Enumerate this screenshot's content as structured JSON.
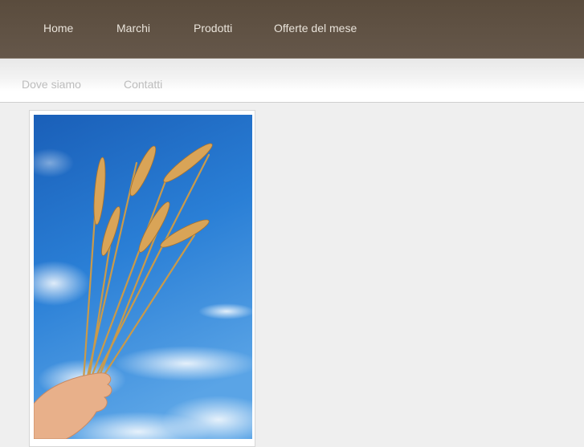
{
  "nav": {
    "primary": [
      {
        "label": "Home"
      },
      {
        "label": "Marchi"
      },
      {
        "label": "Prodotti"
      },
      {
        "label": "Offerte del mese"
      }
    ],
    "secondary": [
      {
        "label": "Dove siamo"
      },
      {
        "label": "Contatti"
      }
    ]
  },
  "colors": {
    "topbar": "#5f5142",
    "nav_text": "#e9e3da",
    "subnav_text": "#bdbdbd",
    "page_bg": "#efefef",
    "sky": "#1f6fc9"
  },
  "hero_image": {
    "icon": "wheat-in-hand-photo"
  }
}
